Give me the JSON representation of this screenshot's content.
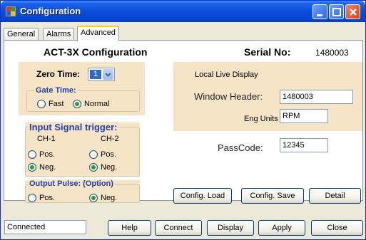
{
  "window": {
    "title": "Configuration"
  },
  "tabs": [
    {
      "label": "General"
    },
    {
      "label": "Alarms"
    },
    {
      "label": "Advanced"
    }
  ],
  "header": {
    "config_title": "ACT-3X Configuration",
    "serial_label": "Serial No:",
    "serial_value": "1480003"
  },
  "zero_time": {
    "label": "Zero Time:",
    "value": "1"
  },
  "gate_time": {
    "label": "Gate Time:",
    "options": [
      "Fast",
      "Normal"
    ],
    "selected": "Normal"
  },
  "input_trigger": {
    "label": "Input Signal trigger:",
    "ch1": {
      "label": "CH-1",
      "options": [
        "Pos.",
        "Neg."
      ],
      "selected": "Neg."
    },
    "ch2": {
      "label": "CH-2",
      "options": [
        "Pos.",
        "Neg."
      ],
      "selected": "Neg."
    }
  },
  "output_pulse": {
    "label": "Output Pulse: (Option)",
    "options": [
      "Pos.",
      "Neg."
    ],
    "selected": "Neg."
  },
  "live_display": {
    "label": "Local Live Display",
    "window_header_label": "Window Header:",
    "window_header_value": "1480003",
    "eng_units_label": "Eng Units",
    "eng_units_value": "RPM"
  },
  "passcode": {
    "label": "PassCode:",
    "value": "12345"
  },
  "panel_buttons": {
    "config_load": "Config. Load",
    "config_save": "Config. Save",
    "detail": "Detail"
  },
  "status": {
    "text": "Connected"
  },
  "footer_buttons": {
    "help": "Help",
    "connect": "Connect",
    "display": "Display",
    "apply": "Apply",
    "close": "Close"
  },
  "colors": {
    "titlebar": "#0a4edb",
    "section_bg": "#f6e4c6",
    "group_label": "#1f3ea9",
    "radio_check": "#21a121"
  }
}
